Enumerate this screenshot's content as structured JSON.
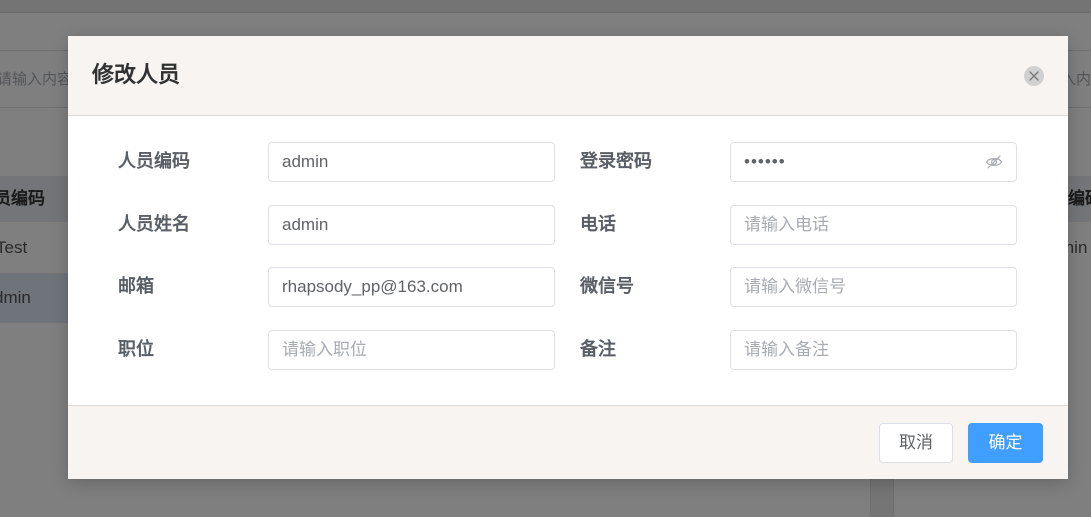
{
  "background": {
    "search_left_placeholder": "请输入内容",
    "search_right_placeholder": "入内容",
    "table_header_left": "员编码",
    "table_header_right": "编码",
    "row_1_left": "Test",
    "row_2_left": "dmin",
    "row_1_right": "min"
  },
  "dialog": {
    "title": "修改人员",
    "close_icon": "close-icon",
    "fields": {
      "code": {
        "label": "人员编码",
        "value": "admin",
        "placeholder": ""
      },
      "password": {
        "label": "登录密码",
        "value": "••••••",
        "placeholder": "",
        "icon": "eye-off-icon"
      },
      "name": {
        "label": "人员姓名",
        "value": "admin",
        "placeholder": ""
      },
      "phone": {
        "label": "电话",
        "value": "",
        "placeholder": "请输入电话"
      },
      "email": {
        "label": "邮箱",
        "value": "rhapsody_pp@163.com",
        "placeholder": ""
      },
      "wechat": {
        "label": "微信号",
        "value": "",
        "placeholder": "请输入微信号"
      },
      "position": {
        "label": "职位",
        "value": "",
        "placeholder": "请输入职位"
      },
      "remark": {
        "label": "备注",
        "value": "",
        "placeholder": "请输入备注"
      }
    },
    "buttons": {
      "cancel": "取消",
      "confirm": "确定"
    }
  },
  "colors": {
    "primary": "#409eff",
    "overlay": "rgba(0,0,0,0.5)",
    "dialog_header_bg": "#f8f4f2"
  }
}
